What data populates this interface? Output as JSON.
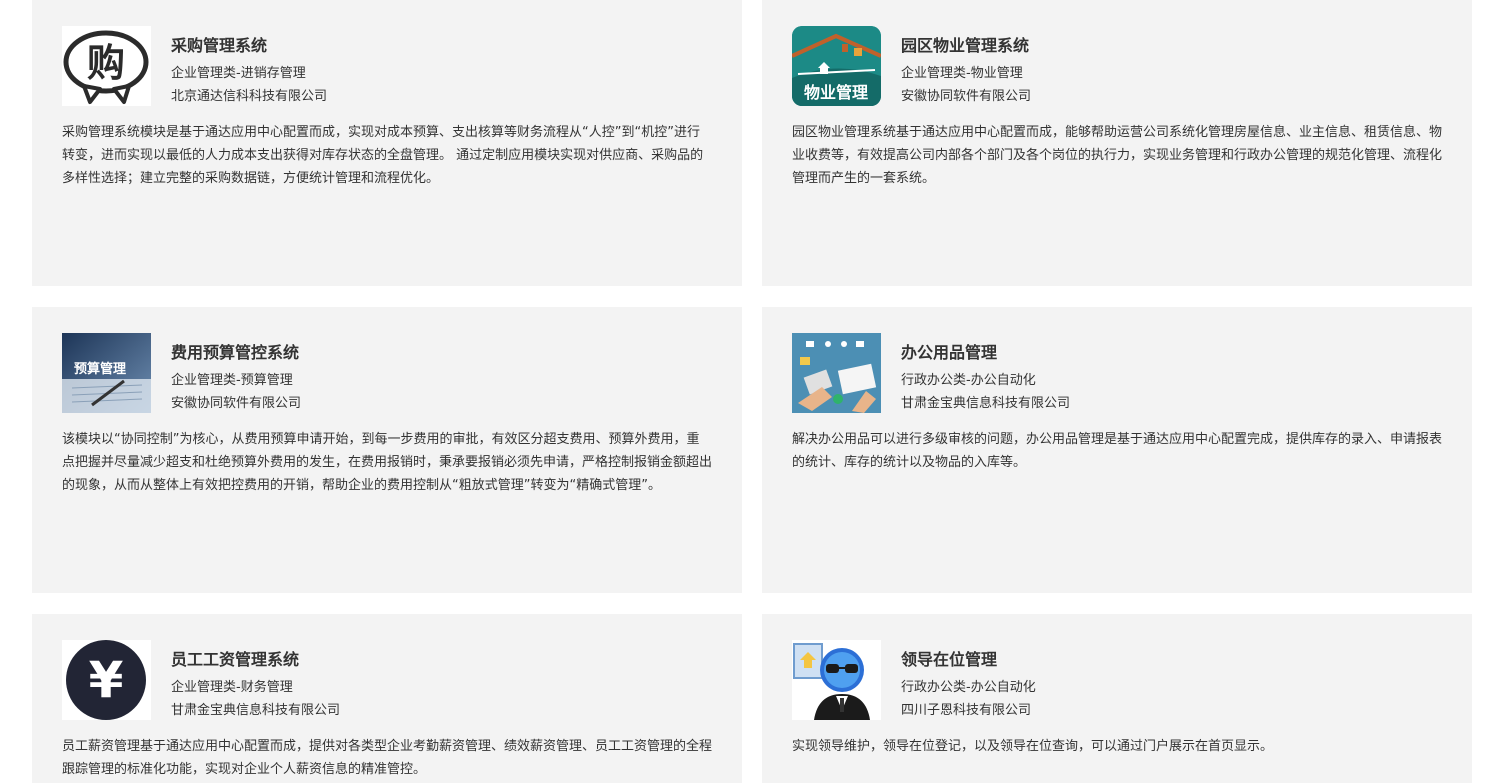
{
  "cards": [
    {
      "icon": "shopping-bubble-icon",
      "title": "采购管理系统",
      "category": "企业管理类-进销存管理",
      "company": "北京通达信科科技有限公司",
      "description": "采购管理系统模块是基于通达应用中心配置而成，实现对成本预算、支出核算等财务流程从“人控”到“机控”进行转变，进而实现以最低的人力成本支出获得对库存状态的全盘管理。 通过定制应用模块实现对供应商、采购品的多样性选择；建立完整的采购数据链，方便统计管理和流程优化。"
    },
    {
      "icon": "property-house-icon",
      "icon_text": "物业管理",
      "title": "园区物业管理系统",
      "category": "企业管理类-物业管理",
      "company": "安徽协同软件有限公司",
      "description": "园区物业管理系统基于通达应用中心配置而成，能够帮助运营公司系统化管理房屋信息、业主信息、租赁信息、物业收费等，有效提高公司内部各个部门及各个岗位的执行力，实现业务管理和行政办公管理的规范化管理、流程化管理而产生的一套系统。"
    },
    {
      "icon": "budget-photo-icon",
      "icon_text": "预算管理",
      "title": "费用预算管控系统",
      "category": "企业管理类-预算管理",
      "company": "安徽协同软件有限公司",
      "description": "该模块以“协同控制”为核心，从费用预算申请开始，到每一步费用的审批，有效区分超支费用、预算外费用，重点把握并尽量减少超支和杜绝预算外费用的发生，在费用报销时，秉承要报销必须先申请，严格控制报销金额超出的现象，从而从整体上有效把控费用的开销，帮助企业的费用控制从“粗放式管理”转变为“精确式管理”。"
    },
    {
      "icon": "office-supplies-icon",
      "title": "办公用品管理",
      "category": "行政办公类-办公自动化",
      "company": "甘肃金宝典信息科技有限公司",
      "description": "解决办公用品可以进行多级审核的问题，办公用品管理是基于通达应用中心配置完成，提供库存的录入、申请报表的统计、库存的统计以及物品的入库等。"
    },
    {
      "icon": "yen-icon",
      "icon_text": "¥",
      "title": "员工工资管理系统",
      "category": "企业管理类-财务管理",
      "company": "甘肃金宝典信息科技有限公司",
      "description": "员工薪资管理基于通达应用中心配置而成，提供对各类型企业考勤薪资管理、绩效薪资管理、员工工资管理的全程跟踪管理的标准化功能，实现对企业个人薪资信息的精准管控。"
    },
    {
      "icon": "leader-presence-icon",
      "title": "领导在位管理",
      "category": "行政办公类-办公自动化",
      "company": "四川子恩科技有限公司",
      "description": "实现领导维护，领导在位登记，以及领导在位查询，可以通过门户展示在首页显示。"
    }
  ],
  "colors": {
    "card_bg": "#f3f3f3",
    "property_teal": "#1c8a86",
    "budget_blue": "#2a4d7a",
    "office_blue": "#4c8fb4",
    "yen_dark": "#222535"
  }
}
